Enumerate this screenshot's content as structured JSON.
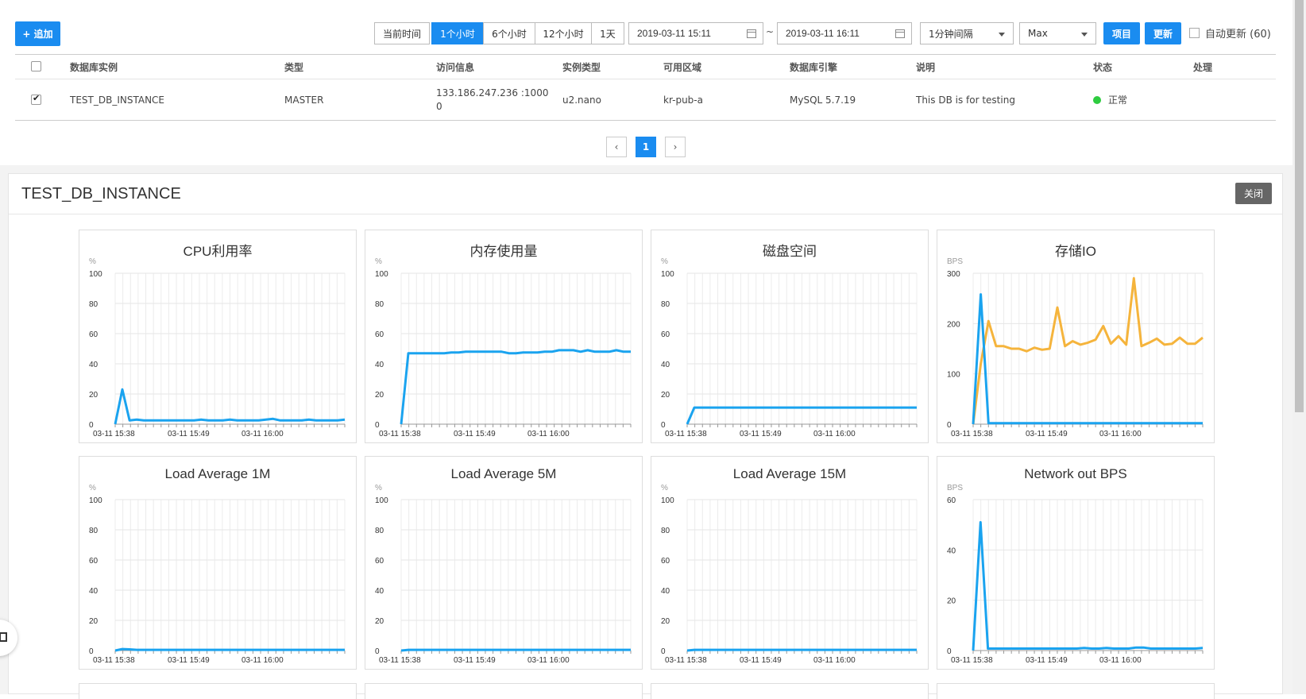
{
  "toolbar": {
    "add_label": "+ 追加",
    "ranges": [
      "当前时间",
      "1个小时",
      "6个小时",
      "12个小时",
      "1天"
    ],
    "active_range": "1个小时",
    "start_date": "2019-03-11 15:11",
    "end_date": "2019-03-11 16:11",
    "separator": "~",
    "interval": "1分钟间隔",
    "aggregate": "Max",
    "items_label": "项目",
    "refresh_label": "更新",
    "auto_refresh_label": "自动更新 (60)"
  },
  "table": {
    "headers": [
      "数据库实例",
      "类型",
      "访问信息",
      "实例类型",
      "可用区域",
      "数据库引擎",
      "说明",
      "状态",
      "处理"
    ],
    "rows": [
      {
        "checked": true,
        "instance": "TEST_DB_INSTANCE",
        "type": "MASTER",
        "access_line1": "133.186.247.236 :1000",
        "access_line2": "0",
        "instance_type": "u2.nano",
        "zone": "kr-pub-a",
        "engine": "MySQL 5.7.19",
        "description": "This DB is for testing",
        "status": "正常",
        "status_color": "#2ecc40",
        "action": ""
      }
    ]
  },
  "pagination": {
    "prev": "‹",
    "current": "1",
    "next": "›"
  },
  "detail": {
    "title": "TEST_DB_INSTANCE",
    "close_label": "关闭"
  },
  "colors": {
    "accent": "#1a8cf0",
    "line_blue": "#1aa3ef",
    "line_orange": "#f5b43c"
  },
  "chart_data": [
    {
      "type": "line",
      "title": "CPU利用率",
      "ylabel": "%",
      "ylim": [
        0,
        100
      ],
      "yticks": [
        0,
        20,
        40,
        60,
        80,
        100
      ],
      "xticks": [
        "03-11 15:38",
        "03-11 15:49",
        "03-11 16:00"
      ],
      "series": [
        {
          "color": "#1aa3ef",
          "values": [
            0,
            23,
            2.5,
            3,
            2.5,
            2.5,
            2.5,
            2.5,
            2.5,
            2.5,
            2.5,
            2.5,
            3,
            2.5,
            2.5,
            2.5,
            3,
            2.5,
            2.5,
            2.5,
            2.5,
            3,
            3.5,
            2.5,
            2.5,
            2.5,
            2.5,
            3,
            2.5,
            2.5,
            2.5,
            2.5,
            3
          ]
        }
      ]
    },
    {
      "type": "line",
      "title": "内存使用量",
      "ylabel": "%",
      "ylim": [
        0,
        100
      ],
      "yticks": [
        0,
        20,
        40,
        60,
        80,
        100
      ],
      "xticks": [
        "03-11 15:38",
        "03-11 15:49",
        "03-11 16:00"
      ],
      "series": [
        {
          "color": "#1aa3ef",
          "values": [
            0,
            47,
            47,
            47,
            47,
            47,
            47,
            47.5,
            47.5,
            48,
            48,
            48,
            48,
            48,
            48,
            47,
            47,
            47.5,
            47.5,
            47.5,
            48,
            48,
            49,
            49,
            49,
            48,
            49,
            48,
            48,
            48,
            49,
            48,
            48
          ]
        }
      ]
    },
    {
      "type": "line",
      "title": "磁盘空间",
      "ylabel": "%",
      "ylim": [
        0,
        100
      ],
      "yticks": [
        0,
        20,
        40,
        60,
        80,
        100
      ],
      "xticks": [
        "03-11 15:38",
        "03-11 15:49",
        "03-11 16:00"
      ],
      "series": [
        {
          "color": "#1aa3ef",
          "values": [
            0,
            11,
            11,
            11,
            11,
            11,
            11,
            11,
            11,
            11,
            11,
            11,
            11,
            11,
            11,
            11,
            11,
            11,
            11,
            11,
            11,
            11,
            11,
            11,
            11,
            11,
            11,
            11,
            11,
            11,
            11,
            11,
            11
          ]
        }
      ]
    },
    {
      "type": "line",
      "title": "存储IO",
      "ylabel": "BPS",
      "ylim": [
        0,
        300
      ],
      "yticks": [
        0,
        100,
        200,
        300
      ],
      "xticks": [
        "03-11 15:38",
        "03-11 15:49",
        "03-11 16:00"
      ],
      "series": [
        {
          "color": "#f5b43c",
          "values": [
            0,
            120,
            205,
            155,
            155,
            150,
            150,
            145,
            152,
            148,
            150,
            232,
            155,
            165,
            158,
            162,
            168,
            195,
            160,
            175,
            158,
            290,
            155,
            162,
            170,
            158,
            160,
            172,
            160,
            160,
            172
          ]
        },
        {
          "color": "#1aa3ef",
          "values": [
            0,
            258,
            2,
            2,
            2,
            2,
            2,
            2,
            2,
            2,
            2,
            2,
            2,
            2,
            2,
            2,
            2,
            2,
            2,
            2,
            2,
            2,
            2,
            2,
            2,
            2,
            2,
            2,
            2,
            2,
            2
          ]
        }
      ]
    },
    {
      "type": "line",
      "title": "Load Average 1M",
      "ylabel": "%",
      "ylim": [
        0,
        100
      ],
      "yticks": [
        0,
        20,
        40,
        60,
        80,
        100
      ],
      "xticks": [
        "03-11 15:38",
        "03-11 15:49",
        "03-11 16:00"
      ],
      "series": [
        {
          "color": "#1aa3ef",
          "values": [
            0,
            1,
            0.8,
            0.5,
            0.5,
            0.5,
            0.5,
            0.5,
            0.5,
            0.5,
            0.5,
            0.5,
            0.5,
            0.5,
            0.5,
            0.5,
            0.5,
            0.5,
            0.5,
            0.5,
            0.5,
            0.5,
            0.5,
            0.5,
            0.5,
            0.5,
            0.5,
            0.5,
            0.5,
            0.5,
            0.5,
            0.5,
            0.5
          ]
        }
      ]
    },
    {
      "type": "line",
      "title": "Load Average 5M",
      "ylabel": "%",
      "ylim": [
        0,
        100
      ],
      "yticks": [
        0,
        20,
        40,
        60,
        80,
        100
      ],
      "xticks": [
        "03-11 15:38",
        "03-11 15:49",
        "03-11 16:00"
      ],
      "series": [
        {
          "color": "#1aa3ef",
          "values": [
            0,
            0.5,
            0.5,
            0.5,
            0.5,
            0.5,
            0.5,
            0.5,
            0.5,
            0.5,
            0.5,
            0.5,
            0.5,
            0.5,
            0.5,
            0.5,
            0.5,
            0.5,
            0.5,
            0.5,
            0.5,
            0.5,
            0.5,
            0.5,
            0.5,
            0.5,
            0.5,
            0.5,
            0.5,
            0.5,
            0.5,
            0.5,
            0.5
          ]
        }
      ]
    },
    {
      "type": "line",
      "title": "Load Average 15M",
      "ylabel": "%",
      "ylim": [
        0,
        100
      ],
      "yticks": [
        0,
        20,
        40,
        60,
        80,
        100
      ],
      "xticks": [
        "03-11 15:38",
        "03-11 15:49",
        "03-11 16:00"
      ],
      "series": [
        {
          "color": "#1aa3ef",
          "values": [
            0,
            0.5,
            0.5,
            0.5,
            0.5,
            0.5,
            0.5,
            0.5,
            0.5,
            0.5,
            0.5,
            0.5,
            0.5,
            0.5,
            0.5,
            0.5,
            0.5,
            0.5,
            0.5,
            0.5,
            0.5,
            0.5,
            0.5,
            0.5,
            0.5,
            0.5,
            0.5,
            0.5,
            0.5,
            0.5,
            0.5,
            0.5,
            0.5
          ]
        }
      ]
    },
    {
      "type": "line",
      "title": "Network out BPS",
      "ylabel": "BPS",
      "ylim": [
        0,
        60
      ],
      "yticks": [
        0,
        20,
        40,
        60
      ],
      "xticks": [
        "03-11 15:38",
        "03-11 15:49",
        "03-11 16:00"
      ],
      "series": [
        {
          "color": "#1aa3ef",
          "values": [
            0,
            51,
            0.8,
            0.8,
            0.8,
            0.8,
            0.8,
            0.8,
            0.8,
            0.8,
            0.8,
            0.8,
            0.8,
            0.8,
            0.8,
            1,
            0.8,
            0.8,
            1,
            0.8,
            0.8,
            0.8,
            1.2,
            1.2,
            0.8,
            0.8,
            0.8,
            0.8,
            0.8,
            0.8,
            0.8,
            1
          ]
        }
      ]
    }
  ]
}
